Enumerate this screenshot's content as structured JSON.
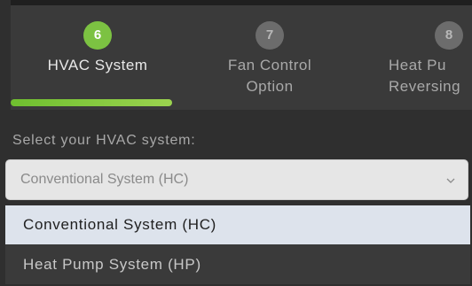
{
  "stepper": {
    "steps": [
      {
        "number": "6",
        "label_line1": "HVAC System",
        "label_line2": "",
        "state": "active"
      },
      {
        "number": "7",
        "label_line1": "Fan Control",
        "label_line2": "Option",
        "state": "inactive"
      },
      {
        "number": "8",
        "label_line1": "Heat Pu",
        "label_line2": "Reversing",
        "state": "inactive"
      }
    ],
    "progress_percent": 35
  },
  "form": {
    "prompt": "Select your HVAC system:",
    "select": {
      "value": "Conventional System (HC)",
      "options": [
        {
          "label": "Conventional System (HC)",
          "highlighted": true
        },
        {
          "label": "Heat Pump System (HP)",
          "highlighted": false
        }
      ]
    }
  },
  "icons": {
    "dropdown": "chevron-down-icon"
  },
  "colors": {
    "accent": "#7cc242"
  }
}
